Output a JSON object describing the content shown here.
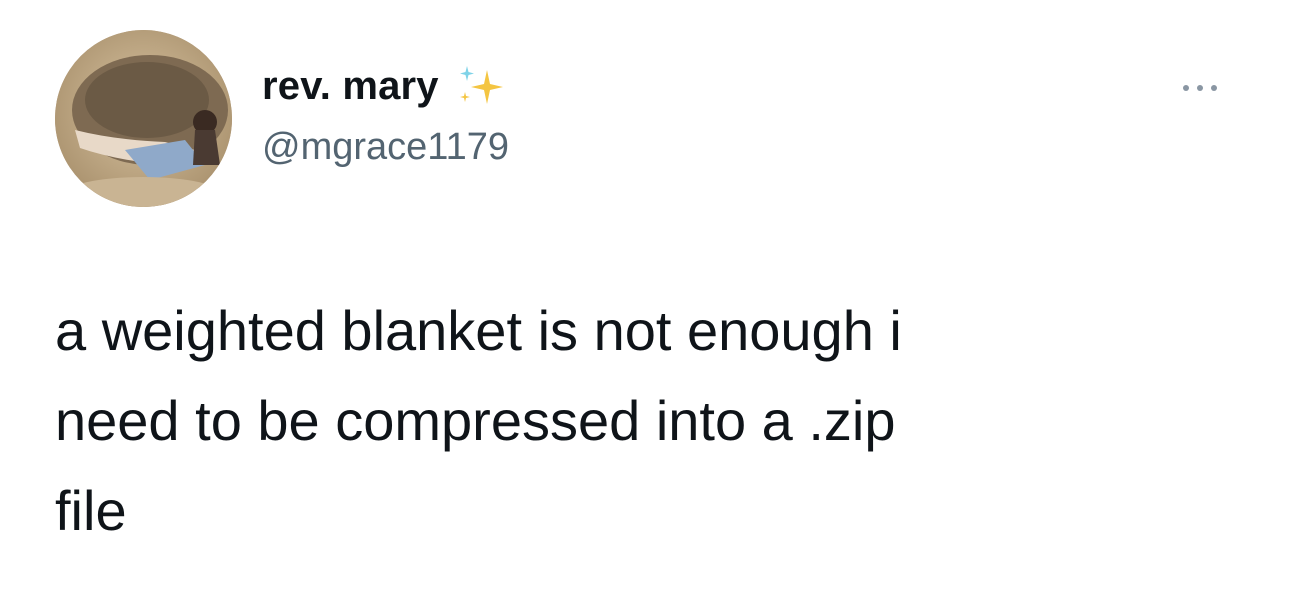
{
  "author": {
    "display_name": "rev. mary",
    "handle": "@mgrace1179",
    "name_emoji_icon": "sparkles-icon",
    "avatar_icon": "profile-photo"
  },
  "menu": {
    "icon": "more-options-icon"
  },
  "tweet": {
    "lines": [
      "a weighted blanket is not enough i",
      "need to be compressed into a .zip",
      "file"
    ]
  },
  "colors": {
    "text_primary": "#0f1419",
    "text_secondary": "#536471",
    "sparkle_yellow": "#f4c542",
    "sparkle_cyan": "#7fd3e8"
  }
}
